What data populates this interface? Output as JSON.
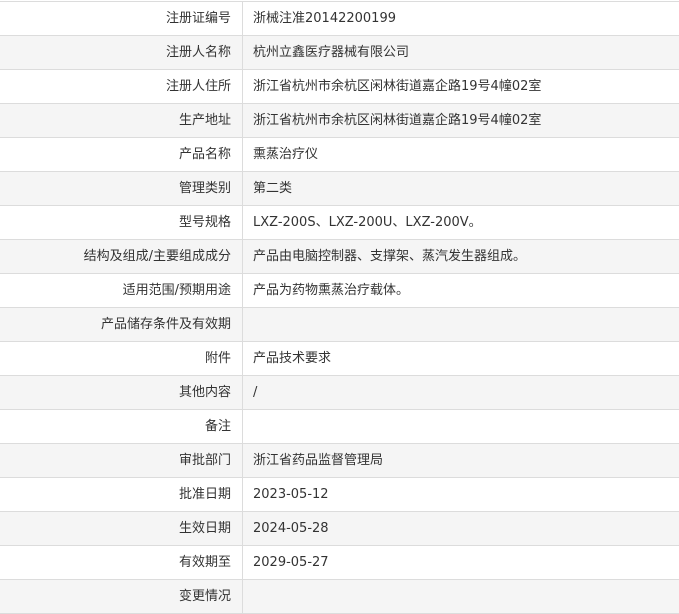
{
  "rows": [
    {
      "label": "注册证编号",
      "value": "浙械注准20142200199"
    },
    {
      "label": "注册人名称",
      "value": "杭州立鑫医疗器械有限公司"
    },
    {
      "label": "注册人住所",
      "value": "浙江省杭州市余杭区闲林街道嘉企路19号4幢02室"
    },
    {
      "label": "生产地址",
      "value": "浙江省杭州市余杭区闲林街道嘉企路19号4幢02室"
    },
    {
      "label": "产品名称",
      "value": "熏蒸治疗仪"
    },
    {
      "label": "管理类别",
      "value": "第二类"
    },
    {
      "label": "型号规格",
      "value": "LXZ-200S、LXZ-200U、LXZ-200V。"
    },
    {
      "label": "结构及组成/主要组成成分",
      "value": "产品由电脑控制器、支撑架、蒸汽发生器组成。"
    },
    {
      "label": "适用范围/预期用途",
      "value": "产品为药物熏蒸治疗载体。"
    },
    {
      "label": "产品储存条件及有效期",
      "value": ""
    },
    {
      "label": "附件",
      "value": "产品技术要求"
    },
    {
      "label": "其他内容",
      "value": "/"
    },
    {
      "label": "备注",
      "value": ""
    },
    {
      "label": "审批部门",
      "value": "浙江省药品监督管理局"
    },
    {
      "label": "批准日期",
      "value": "2023-05-12"
    },
    {
      "label": "生效日期",
      "value": "2024-05-28"
    },
    {
      "label": "有效期至",
      "value": "2029-05-27"
    },
    {
      "label": "变更情况",
      "value": ""
    }
  ]
}
